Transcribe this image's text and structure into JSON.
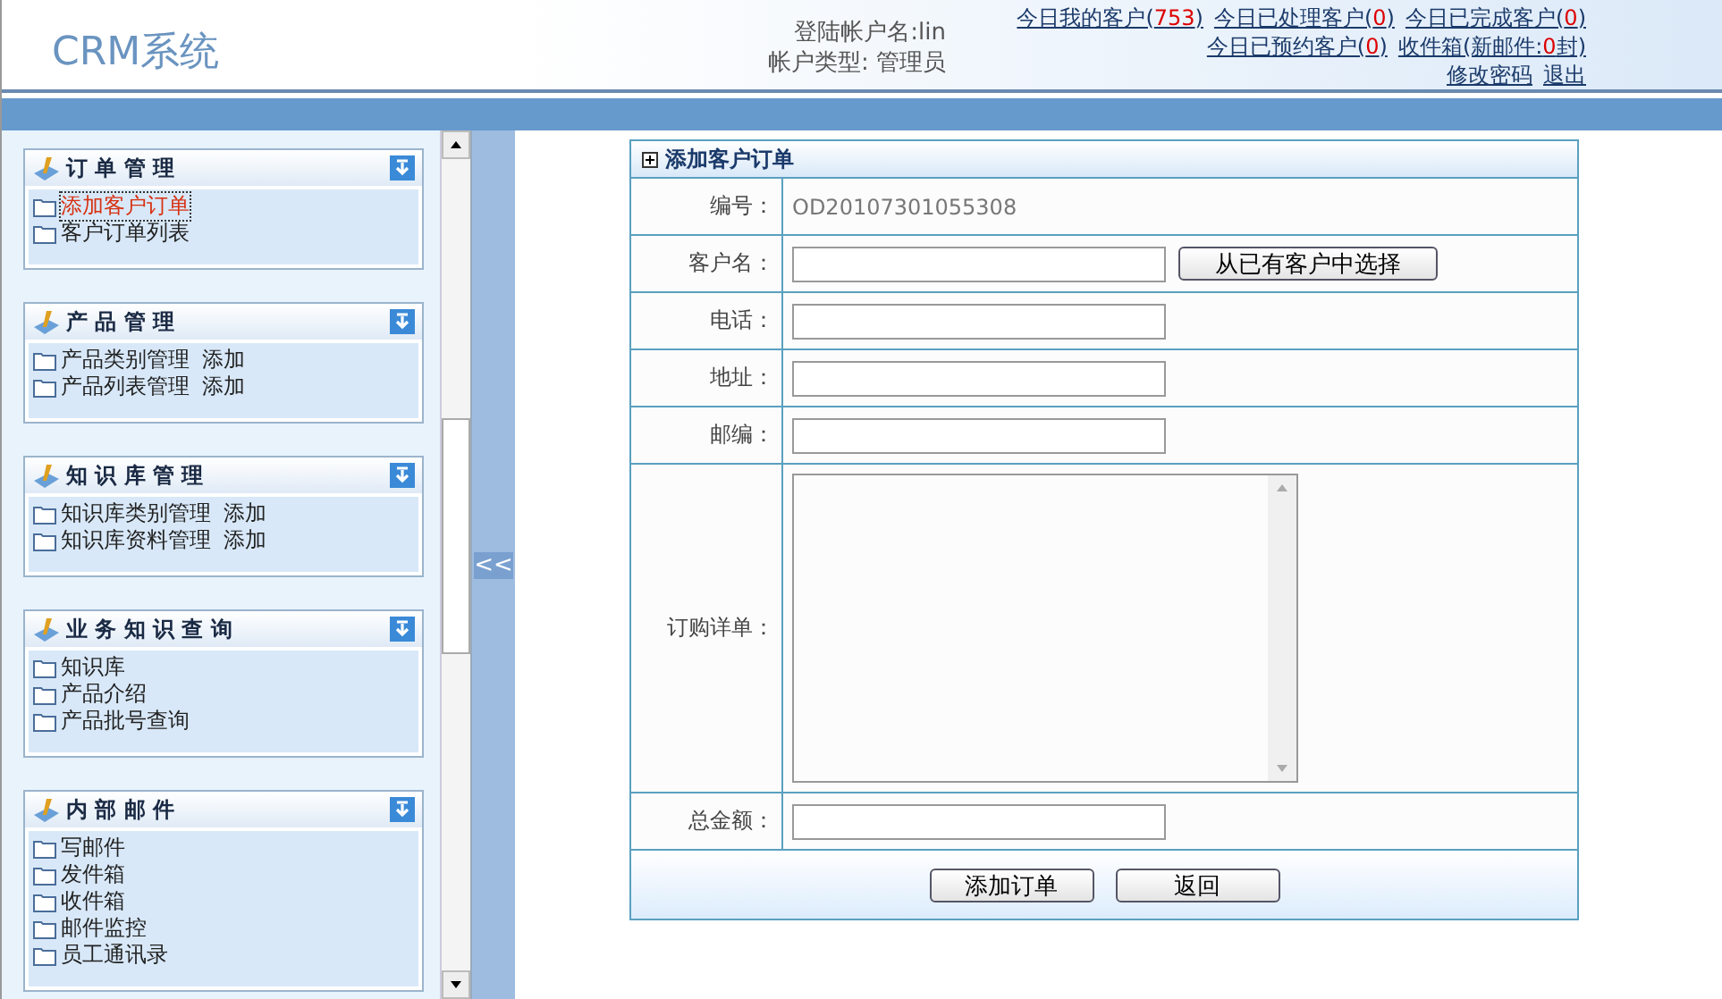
{
  "header": {
    "logo": "CRM系统",
    "account_name": "登陆帐户名:lin",
    "account_type": "帐户类型: 管理员",
    "links": [
      [
        {
          "label": "今日我的客户(",
          "count": "753",
          "suffix": ")"
        },
        {
          "label": "今日已处理客户(",
          "count": "0",
          "suffix": ")"
        },
        {
          "label": "今日已完成客户(",
          "count": "0",
          "suffix": ")"
        }
      ],
      [
        {
          "label": "今日已预约客户(",
          "count": "0",
          "suffix": ")"
        },
        {
          "label": "收件箱(新邮件:",
          "count": "0",
          "suffix": "封)"
        }
      ],
      [
        {
          "label": "修改密码"
        },
        {
          "label": "退出"
        }
      ]
    ]
  },
  "sidebar": {
    "sections": [
      {
        "title": "订 单 管 理",
        "items": [
          {
            "label": "添加客户订单",
            "selected": true
          },
          {
            "label": "客户订单列表",
            "selected": false
          }
        ]
      },
      {
        "title": "产 品 管 理",
        "items": [
          {
            "label": "产品类别管理",
            "add": "添加",
            "selected": false
          },
          {
            "label": "产品列表管理",
            "add": "添加",
            "selected": false
          }
        ]
      },
      {
        "title": "知 识 库 管 理",
        "items": [
          {
            "label": "知识库类别管理",
            "add": "添加",
            "selected": false
          },
          {
            "label": "知识库资料管理",
            "add": "添加",
            "selected": false
          }
        ]
      },
      {
        "title": "业 务 知 识 查 询",
        "items": [
          {
            "label": "知识库",
            "selected": false
          },
          {
            "label": "产品介绍",
            "selected": false
          },
          {
            "label": "产品批号查询",
            "selected": false
          }
        ]
      },
      {
        "title": "内 部 邮 件",
        "items": [
          {
            "label": "写邮件",
            "selected": false
          },
          {
            "label": "发件箱",
            "selected": false
          },
          {
            "label": "收件箱",
            "selected": false
          },
          {
            "label": "邮件监控",
            "selected": false
          },
          {
            "label": "员工通讯录",
            "selected": false
          }
        ]
      }
    ]
  },
  "splitter": {
    "label": "<<"
  },
  "form": {
    "title": "添加客户订单",
    "rows": [
      {
        "kind": "text",
        "label": "编号：",
        "value": "OD20107301055308"
      },
      {
        "kind": "input_button",
        "label": "客户名：",
        "button": "从已有客户中选择"
      },
      {
        "kind": "input",
        "label": "电话："
      },
      {
        "kind": "input",
        "label": "地址："
      },
      {
        "kind": "input",
        "label": "邮编："
      },
      {
        "kind": "textarea",
        "label": "订购详单："
      },
      {
        "kind": "input",
        "label": "总金额："
      }
    ],
    "buttons": [
      "添加订单",
      "返回"
    ]
  }
}
